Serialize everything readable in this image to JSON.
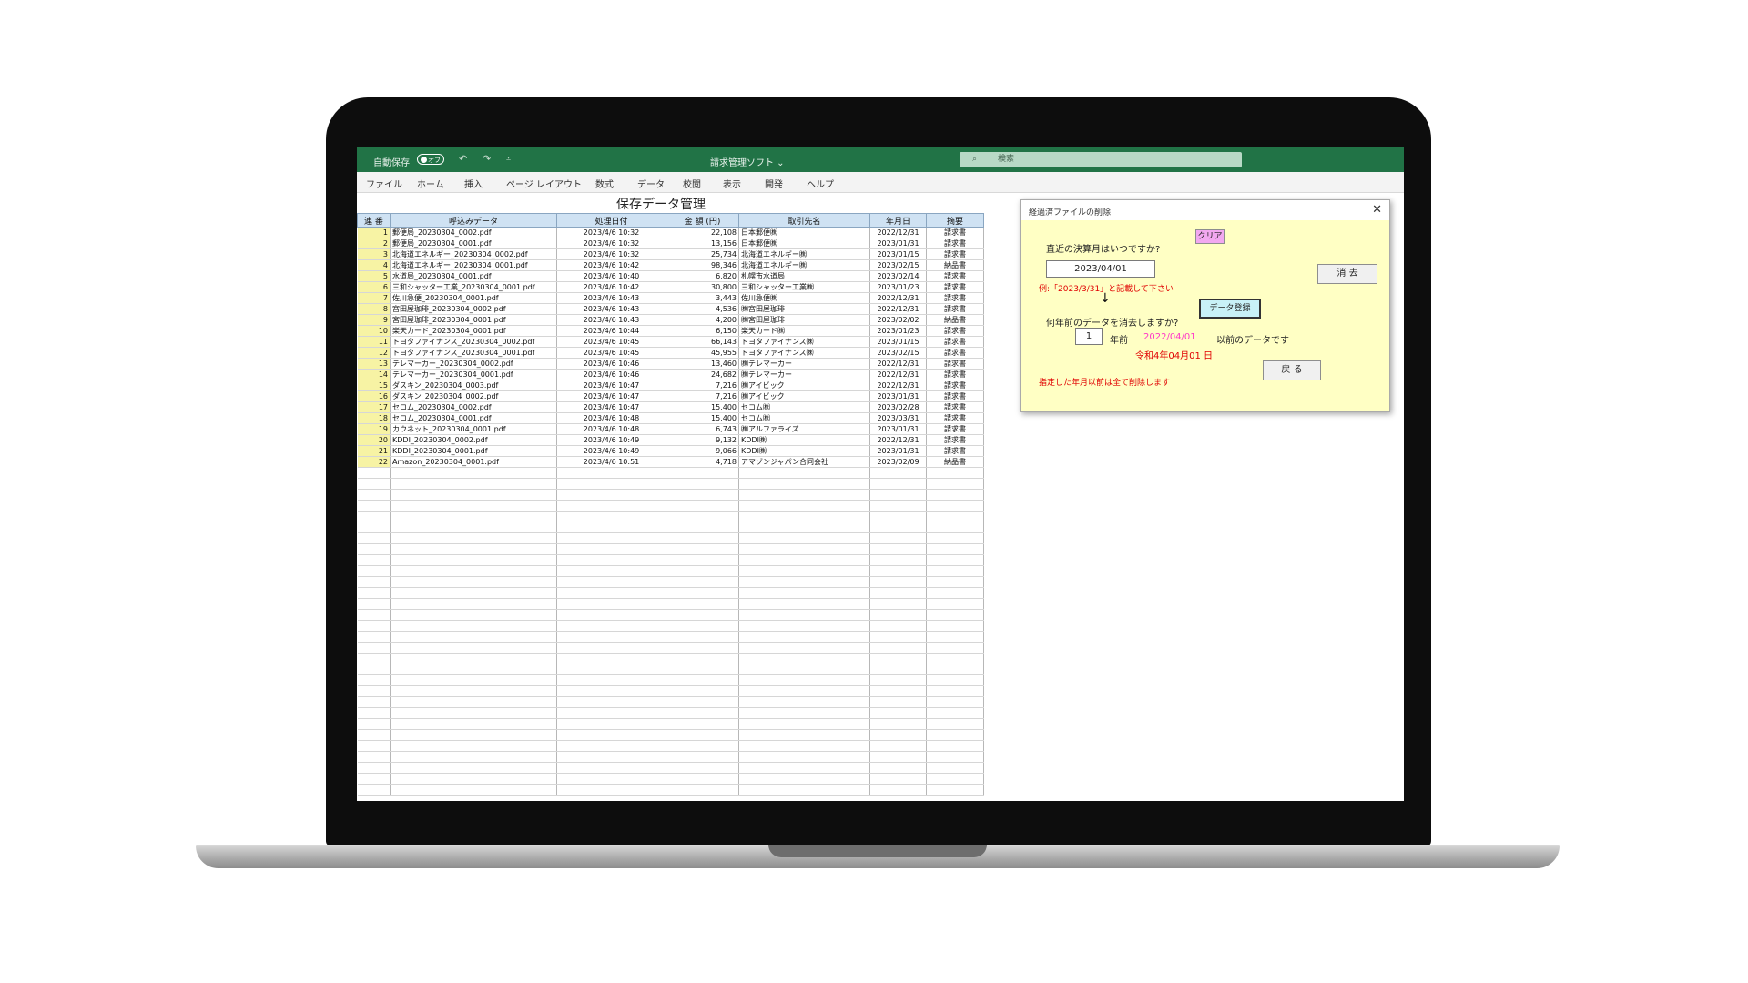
{
  "titlebar": {
    "autosave_label": "自動保存",
    "autosave_state": "オフ",
    "undo_icon": "↶",
    "redo_icon": "↷",
    "customize_icon": "⩡",
    "doc_title": "請求管理ソフト ⌄",
    "search_placeholder": "検索",
    "search_icon": "⌕",
    "accent_color": "#217346"
  },
  "ribbon": {
    "tabs": [
      "ファイル",
      "ホーム",
      "挿入",
      "ページ レイアウト",
      "数式",
      "データ",
      "校閲",
      "表示",
      "開発",
      "ヘルプ"
    ]
  },
  "sheet": {
    "title": "保存データ管理",
    "headers": [
      "連 番",
      "呼込みデータ",
      "処理日付",
      "金 額 (円)",
      "取引先名",
      "年月日",
      "摘要"
    ],
    "rows": [
      [
        "1",
        "郵便局_20230304_0002.pdf",
        "2023/4/6 10:32",
        "22,108",
        "日本郵便㈱",
        "2022/12/31",
        "請求書"
      ],
      [
        "2",
        "郵便局_20230304_0001.pdf",
        "2023/4/6 10:32",
        "13,156",
        "日本郵便㈱",
        "2023/01/31",
        "請求書"
      ],
      [
        "3",
        "北海道エネルギー_20230304_0002.pdf",
        "2023/4/6 10:32",
        "25,734",
        "北海道エネルギー㈱",
        "2023/01/15",
        "請求書"
      ],
      [
        "4",
        "北海道エネルギー_20230304_0001.pdf",
        "2023/4/6 10:42",
        "98,346",
        "北海道エネルギー㈱",
        "2023/02/15",
        "納品書"
      ],
      [
        "5",
        "水道局_20230304_0001.pdf",
        "2023/4/6 10:40",
        "6,820",
        "札幌市水道局",
        "2023/02/14",
        "請求書"
      ],
      [
        "6",
        "三和シャッター工業_20230304_0001.pdf",
        "2023/4/6 10:42",
        "30,800",
        "三和シャッター工業㈱",
        "2023/01/23",
        "請求書"
      ],
      [
        "7",
        "佐川急便_20230304_0001.pdf",
        "2023/4/6 10:43",
        "3,443",
        "佐川急便㈱",
        "2022/12/31",
        "請求書"
      ],
      [
        "8",
        "宮田屋珈琲_20230304_0002.pdf",
        "2023/4/6 10:43",
        "4,536",
        "㈱宮田屋珈琲",
        "2022/12/31",
        "請求書"
      ],
      [
        "9",
        "宮田屋珈琲_20230304_0001.pdf",
        "2023/4/6 10:43",
        "4,200",
        "㈱宮田屋珈琲",
        "2023/02/02",
        "納品書"
      ],
      [
        "10",
        "楽天カード_20230304_0001.pdf",
        "2023/4/6 10:44",
        "6,150",
        "楽天カード㈱",
        "2023/01/23",
        "請求書"
      ],
      [
        "11",
        "トヨタファイナンス_20230304_0002.pdf",
        "2023/4/6 10:45",
        "66,143",
        "トヨタファイナンス㈱",
        "2023/01/15",
        "請求書"
      ],
      [
        "12",
        "トヨタファイナンス_20230304_0001.pdf",
        "2023/4/6 10:45",
        "45,955",
        "トヨタファイナンス㈱",
        "2023/02/15",
        "請求書"
      ],
      [
        "13",
        "テレマーカー_20230304_0002.pdf",
        "2023/4/6 10:46",
        "13,460",
        "㈱テレマーカー",
        "2022/12/31",
        "請求書"
      ],
      [
        "14",
        "テレマーカー_20230304_0001.pdf",
        "2023/4/6 10:46",
        "24,682",
        "㈱テレマーカー",
        "2022/12/31",
        "請求書"
      ],
      [
        "15",
        "ダスキン_20230304_0003.pdf",
        "2023/4/6 10:47",
        "7,216",
        "㈱アイビック",
        "2022/12/31",
        "請求書"
      ],
      [
        "16",
        "ダスキン_20230304_0002.pdf",
        "2023/4/6 10:47",
        "7,216",
        "㈱アイビック",
        "2023/01/31",
        "請求書"
      ],
      [
        "17",
        "セコム_20230304_0002.pdf",
        "2023/4/6 10:47",
        "15,400",
        "セコム㈱",
        "2023/02/28",
        "請求書"
      ],
      [
        "18",
        "セコム_20230304_0001.pdf",
        "2023/4/6 10:48",
        "15,400",
        "セコム㈱",
        "2023/03/31",
        "請求書"
      ],
      [
        "19",
        "カウネット_20230304_0001.pdf",
        "2023/4/6 10:48",
        "6,743",
        "㈱アルファライズ",
        "2023/01/31",
        "請求書"
      ],
      [
        "20",
        "KDDI_20230304_0002.pdf",
        "2023/4/6 10:49",
        "9,132",
        "KDDI㈱",
        "2022/12/31",
        "請求書"
      ],
      [
        "21",
        "KDDI_20230304_0001.pdf",
        "2023/4/6 10:49",
        "9,066",
        "KDDI㈱",
        "2023/01/31",
        "請求書"
      ],
      [
        "22",
        "Amazon_20230304_0001.pdf",
        "2023/4/6 10:51",
        "4,718",
        "アマゾンジャパン合同会社",
        "2023/02/09",
        "納品書"
      ]
    ]
  },
  "dialog": {
    "title": "経過済ファイルの削除",
    "close_label": "✕",
    "question_month": "直近の決算月はいつですか?",
    "clear_label": "クリア",
    "date_value": "2023/04/01",
    "example_note": "例:「2023/3/31」と記載して下さい",
    "delete_label": "消 去",
    "arrow": "↓",
    "register_label": "データ登録",
    "question_years": "何年前のデータを消去しますか?",
    "years_value": "1",
    "years_unit": "年前",
    "cutoff_date": "2022/04/01",
    "before_text": "以前のデータです",
    "wareki_date": "令和4年04月01 日",
    "back_label": "戻 る",
    "warning": "指定した年月以前は全て削除します"
  }
}
